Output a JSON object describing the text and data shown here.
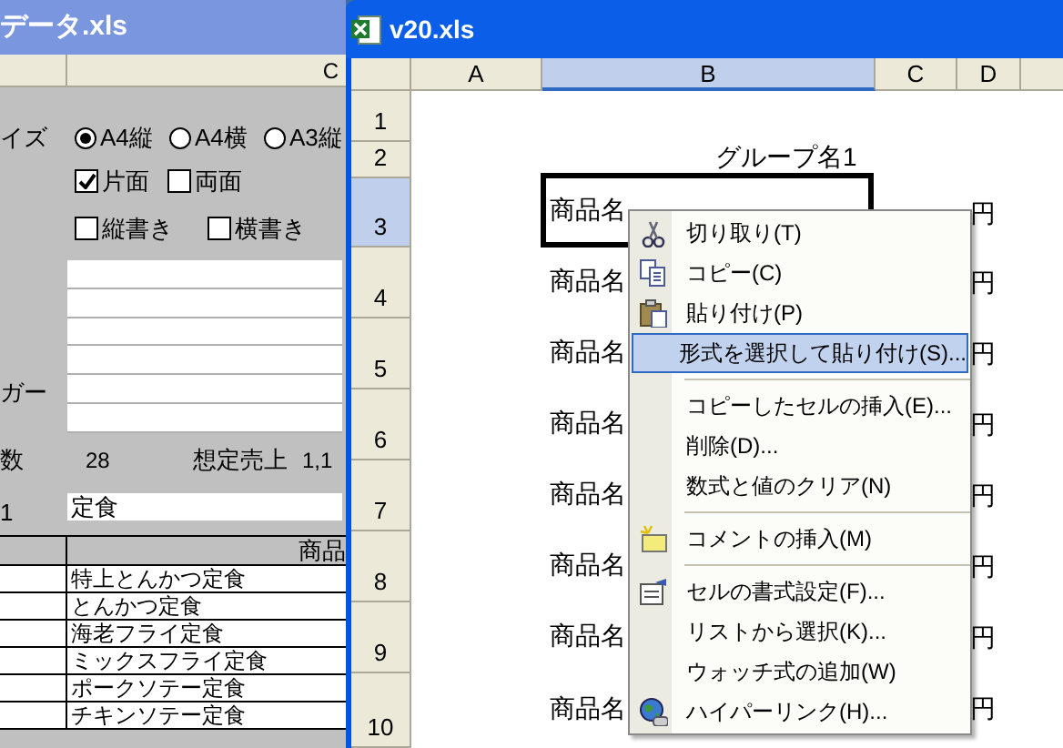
{
  "left_window": {
    "title": "データ.xls",
    "column_header": "C",
    "form": {
      "paper_label": "イズ",
      "paper_options": [
        {
          "label": "A4縦",
          "selected": true
        },
        {
          "label": "A4横",
          "selected": false
        },
        {
          "label": "A3縦",
          "selected": false
        }
      ],
      "sides": [
        {
          "label": "片面",
          "checked": true
        },
        {
          "label": "両面",
          "checked": false
        }
      ],
      "writing": [
        {
          "label": "縦書き",
          "checked": false
        },
        {
          "label": "横書き",
          "checked": false
        }
      ],
      "lines_label": "ガー",
      "count_label": "数",
      "count": "28",
      "sales_label": "想定売上",
      "sales": "1,1",
      "group_label": "1",
      "group_value": "定食"
    },
    "table": {
      "header": "商品",
      "rows": [
        "特上とんかつ定食",
        "とんかつ定食",
        "海老フライ定食",
        "ミックスフライ定食",
        "ポークソテー定食",
        "チキンソテー定食"
      ]
    }
  },
  "right_window": {
    "title": "v20.xls",
    "columns": [
      {
        "label": "A",
        "selected": false
      },
      {
        "label": "B",
        "selected": true
      },
      {
        "label": "C",
        "selected": false
      },
      {
        "label": "D",
        "selected": false
      }
    ],
    "rows": [
      {
        "label": "1",
        "selected": false
      },
      {
        "label": "2",
        "selected": false
      },
      {
        "label": "3",
        "selected": true
      },
      {
        "label": "4",
        "selected": false
      },
      {
        "label": "5",
        "selected": false
      },
      {
        "label": "6",
        "selected": false
      },
      {
        "label": "7",
        "selected": false
      },
      {
        "label": "8",
        "selected": false
      },
      {
        "label": "9",
        "selected": false
      },
      {
        "label": "10",
        "selected": false
      }
    ],
    "group_title": "グループ名1",
    "items": [
      {
        "name": "商品名",
        "unit": "円",
        "selected": true
      },
      {
        "name": "商品名",
        "unit": "円",
        "selected": false
      },
      {
        "name": "商品名",
        "unit": "円",
        "selected": false
      },
      {
        "name": "商品名",
        "unit": "円",
        "selected": false
      },
      {
        "name": "商品名",
        "unit": "円",
        "selected": false
      },
      {
        "name": "商品名",
        "unit": "円",
        "selected": false
      },
      {
        "name": "商品名",
        "unit": "円",
        "selected": false
      },
      {
        "name": "商品名",
        "unit": "円",
        "selected": false
      }
    ],
    "context_menu": [
      {
        "kind": "item",
        "label": "切り取り(T)",
        "selected": false
      },
      {
        "kind": "item",
        "label": "コピー(C)",
        "selected": false
      },
      {
        "kind": "item",
        "label": "貼り付け(P)",
        "selected": false
      },
      {
        "kind": "item",
        "label": "形式を選択して貼り付け(S)...",
        "selected": true
      },
      {
        "kind": "separator"
      },
      {
        "kind": "item",
        "label": "コピーしたセルの挿入(E)...",
        "selected": false
      },
      {
        "kind": "item",
        "label": "削除(D)...",
        "selected": false
      },
      {
        "kind": "item",
        "label": "数式と値のクリア(N)",
        "selected": false
      },
      {
        "kind": "separator"
      },
      {
        "kind": "item",
        "label": "コメントの挿入(M)",
        "selected": false
      },
      {
        "kind": "separator"
      },
      {
        "kind": "item",
        "label": "セルの書式設定(F)...",
        "selected": false
      },
      {
        "kind": "item",
        "label": "リストから選択(K)...",
        "selected": false
      },
      {
        "kind": "item",
        "label": "ウォッチ式の追加(W)",
        "selected": false
      },
      {
        "kind": "item",
        "label": "ハイパーリンク(H)...",
        "selected": false
      }
    ]
  }
}
